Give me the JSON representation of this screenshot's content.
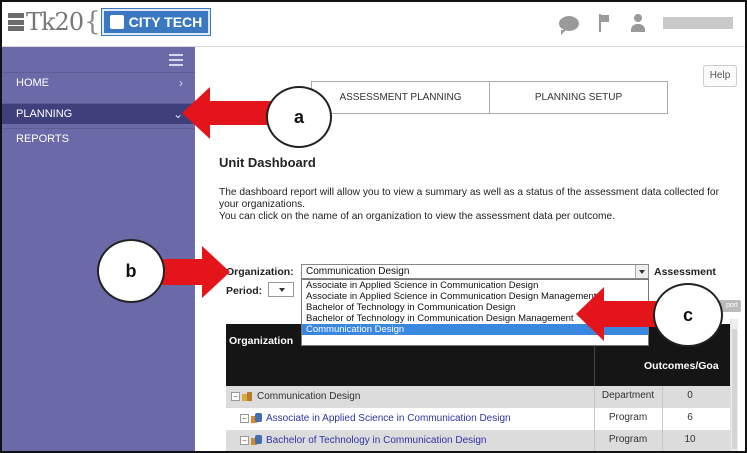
{
  "header": {
    "logo_text": "Tk20",
    "logo_brace": "{",
    "logo_badge": "CITY TECH"
  },
  "sidebar": {
    "items": [
      {
        "label": "HOME",
        "chevron": "›"
      },
      {
        "label": "PLANNING",
        "chevron": "⌄"
      },
      {
        "label": "REPORTS",
        "chevron": ""
      }
    ]
  },
  "main": {
    "help_label": "Help",
    "tabs": [
      {
        "label": "ASSESSMENT PLANNING"
      },
      {
        "label": "PLANNING SETUP"
      }
    ],
    "title": "Unit Dashboard",
    "description": [
      "The dashboard report will allow you to view a summary as well as a status of the assessment data collected for",
      "your organizations.",
      "You can click on the name of an organization to view the assessment data per outcome."
    ],
    "organization_label": "Organization:",
    "organization_value": "Communication Design",
    "assessment_label": "Assessment",
    "period_label": "Period:",
    "dropdown_options": [
      "Associate in Applied Science in Communication Design",
      "Associate in Applied Science in Communication Design Management",
      "Bachelor of Technology in Communication Design",
      "Bachelor of Technology in Communication Design Management",
      "Communication Design"
    ],
    "export_label": "port",
    "table": {
      "col_org": "Organization",
      "col_outcomes": "Outcomes/Goa",
      "rows": [
        {
          "name": "Communication Design",
          "type": "Department",
          "count": "0"
        },
        {
          "name": "Associate in Applied Science in Communication Design",
          "type": "Program",
          "count": "6"
        },
        {
          "name": "Bachelor of Technology in Communication Design",
          "type": "Program",
          "count": "10"
        }
      ]
    }
  },
  "callouts": {
    "a": "a",
    "b": "b",
    "c": "c"
  },
  "colors": {
    "sidebar": "#6a6aa8",
    "sidebar_active": "#3f3f7c",
    "arrow_red": "#e4141b",
    "selected_option": "#3a87e0"
  }
}
